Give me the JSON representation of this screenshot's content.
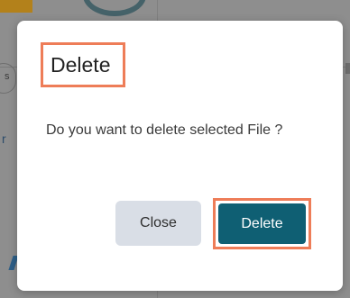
{
  "dialog": {
    "title": "Delete",
    "message": "Do you want to delete selected File ?",
    "buttons": {
      "close_label": "Close",
      "delete_label": "Delete"
    }
  },
  "background": {
    "left_pill_text": "s",
    "left_letter": "r"
  },
  "colors": {
    "highlight": "#ee7d58",
    "primary_button": "#0f5f73",
    "secondary_button": "#d9dee6"
  }
}
